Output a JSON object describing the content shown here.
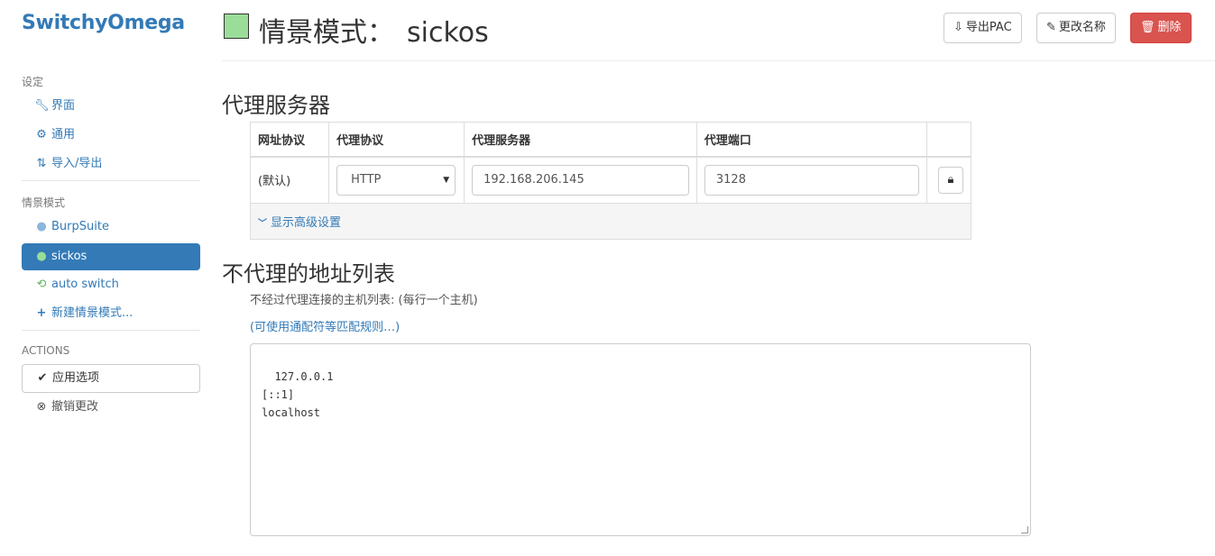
{
  "brand": "SwitchyOmega",
  "sidebar": {
    "settings_header": "设定",
    "settings_items": [
      {
        "label": "界面",
        "icon": "wrench-icon"
      },
      {
        "label": "通用",
        "icon": "gear-icon"
      },
      {
        "label": "导入/导出",
        "icon": "import-export-icon"
      }
    ],
    "profiles_header": "情景模式",
    "profiles": [
      {
        "label": "BurpSuite",
        "icon": "globe-icon"
      },
      {
        "label": "sickos",
        "icon": "globe-icon",
        "active": true
      },
      {
        "label": "auto switch",
        "icon": "retweet-icon"
      },
      {
        "label": "新建情景模式...",
        "icon": "plus-icon"
      }
    ],
    "actions_header": "ACTIONS",
    "apply_label": "应用选项",
    "discard_label": "撤销更改"
  },
  "header": {
    "title_prefix": "情景模式：",
    "profile_name": "sickos",
    "profile_color": "#99dd99",
    "export_pac": "导出PAC",
    "rename": "更改名称",
    "delete": "删除"
  },
  "proxy": {
    "section_title": "代理服务器",
    "columns": [
      "网址协议",
      "代理协议",
      "代理服务器",
      "代理端口"
    ],
    "row": {
      "scheme": "(默认)",
      "protocol": "HTTP",
      "server": "192.168.206.145",
      "port": "3128"
    },
    "advanced_label": "显示高级设置"
  },
  "bypass": {
    "section_title": "不代理的地址列表",
    "help": "不经过代理连接的主机列表: (每行一个主机)",
    "wildcard_link": "(可使用通配符等匹配规则…)",
    "list": "127.0.0.1\n[::1]\nlocalhost"
  },
  "colors": {
    "accent": "#337ab7",
    "danger": "#d9534f"
  }
}
